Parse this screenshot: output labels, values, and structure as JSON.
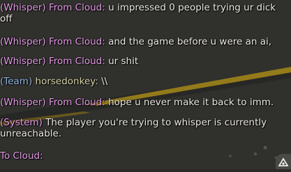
{
  "chat": {
    "messages": [
      {
        "channel": "(Whisper) From Cloud:",
        "text": "u impressed 0 people trying ur dick",
        "text_cont": "off"
      },
      {
        "channel": "(Whisper) From Cloud:",
        "text": "and the game before u were an ai,"
      },
      {
        "channel": "(Whisper) From Cloud:",
        "text": "ur shit"
      },
      {
        "channel": "(Team)",
        "name": "horsedonkey:",
        "text": "\\\\"
      },
      {
        "channel": "(Whisper) From Cloud:",
        "text": "hope u never make it back to imm."
      },
      {
        "channel": "(System)",
        "text": "The player you're trying to whisper is currently",
        "text_cont": "unreachable."
      }
    ]
  },
  "input": {
    "label": "To Cloud:"
  },
  "colors": {
    "whisper": "#e49ae6",
    "team": "#8fb3dc",
    "text": "#ece9e0",
    "background": "#2a2a29",
    "road_stripe": "#a0841a"
  },
  "icons": {
    "corner": "chat-options-icon"
  }
}
